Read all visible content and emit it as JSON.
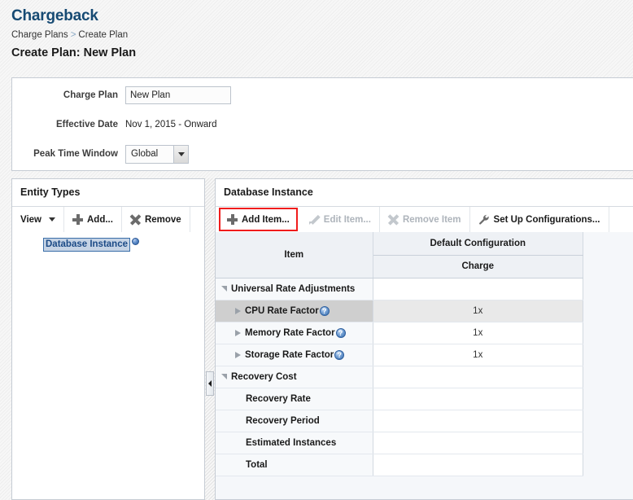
{
  "header": {
    "app_title": "Chargeback",
    "breadcrumb": {
      "parent": "Charge Plans",
      "separator": ">",
      "current": "Create Plan"
    },
    "page_title": "Create Plan: New Plan"
  },
  "form": {
    "charge_plan": {
      "label": "Charge Plan",
      "value": "New Plan",
      "placeholder": ""
    },
    "effective_date": {
      "label": "Effective Date",
      "value": "Nov 1, 2015 - Onward"
    },
    "peak_time_window": {
      "label": "Peak Time Window",
      "value": "Global",
      "arrow_icon": "chevron-down-icon"
    }
  },
  "entity_panel": {
    "title": "Entity Types",
    "toolbar": {
      "view_label": "View",
      "view_icon": "chevron-down-icon",
      "add_label": "Add...",
      "add_icon": "plus-icon",
      "remove_label": "Remove",
      "remove_icon": "x-icon"
    },
    "tree": [
      {
        "label": "Database Instance",
        "selected": true,
        "info_icon": "info-dot-icon"
      }
    ]
  },
  "splitter": {
    "handle_icon": "collapse-left-icon"
  },
  "db_panel": {
    "title": "Database Instance",
    "toolbar": {
      "add_item": {
        "label": "Add Item...",
        "icon": "plus-icon",
        "enabled": true,
        "highlighted": true,
        "highlight_color": "#f01c1c"
      },
      "edit_item": {
        "label": "Edit Item...",
        "icon": "pencil-icon",
        "enabled": false
      },
      "remove_item": {
        "label": "Remove Item",
        "icon": "x-icon",
        "enabled": false
      },
      "set_up_configurations": {
        "label": "Set Up Configurations...",
        "icon": "wrench-icon",
        "enabled": true
      }
    },
    "table": {
      "columns": {
        "item": "Item",
        "group": "Default Configuration",
        "sub": "Charge"
      },
      "rows": [
        {
          "label": "Universal Rate Adjustments",
          "charge": "",
          "indent": 0,
          "twisty": "down",
          "help": false,
          "selected": false
        },
        {
          "label": "CPU Rate Factor",
          "charge": "1x",
          "indent": 1,
          "twisty": "right",
          "help": true,
          "selected": true
        },
        {
          "label": "Memory Rate Factor",
          "charge": "1x",
          "indent": 1,
          "twisty": "right",
          "help": true,
          "selected": false
        },
        {
          "label": "Storage Rate Factor",
          "charge": "1x",
          "indent": 1,
          "twisty": "right",
          "help": true,
          "selected": false
        },
        {
          "label": "Recovery Cost",
          "charge": "",
          "indent": 0,
          "twisty": "down",
          "help": false,
          "selected": false
        },
        {
          "label": "Recovery Rate",
          "charge": "",
          "indent": 2,
          "twisty": "none",
          "help": false,
          "selected": false
        },
        {
          "label": "Recovery Period",
          "charge": "",
          "indent": 2,
          "twisty": "none",
          "help": false,
          "selected": false
        },
        {
          "label": "Estimated Instances",
          "charge": "",
          "indent": 2,
          "twisty": "none",
          "help": false,
          "selected": false
        },
        {
          "label": "Total",
          "charge": "",
          "indent": 2,
          "twisty": "none",
          "help": false,
          "selected": false
        }
      ],
      "help_glyph": "?"
    }
  }
}
